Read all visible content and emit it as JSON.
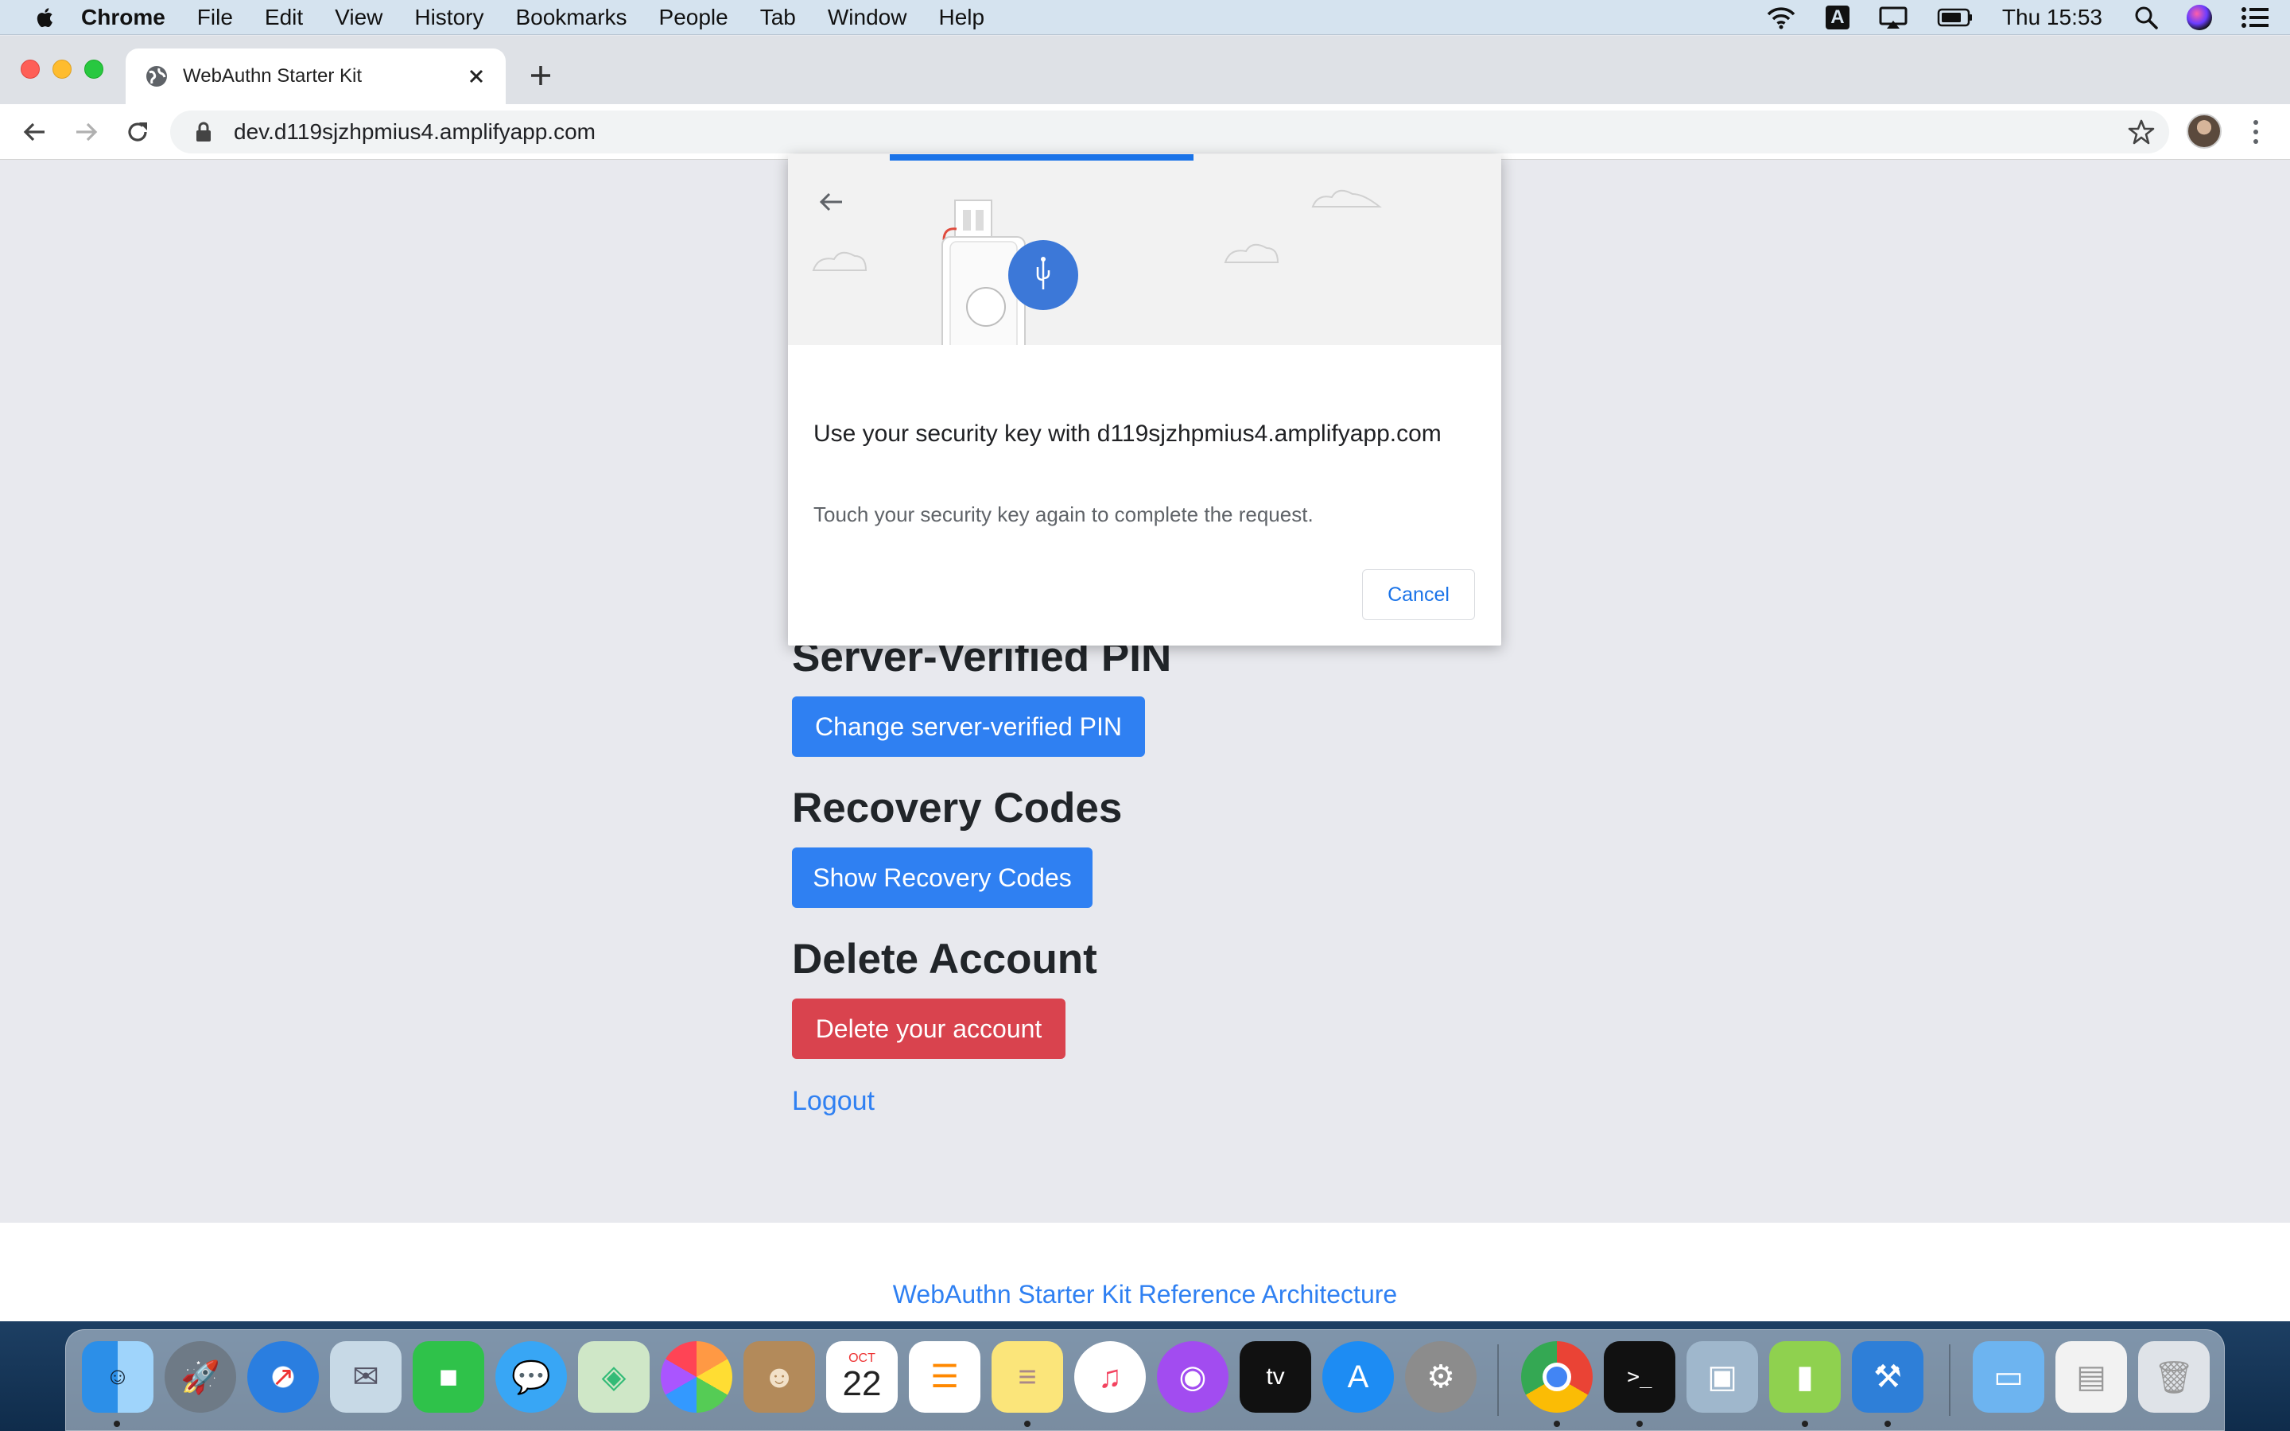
{
  "menubar": {
    "app_name": "Chrome",
    "items": [
      "File",
      "Edit",
      "View",
      "History",
      "Bookmarks",
      "People",
      "Tab",
      "Window",
      "Help"
    ],
    "clock": "Thu 15:53",
    "input_source": "A"
  },
  "browser": {
    "tab_title": "WebAuthn Starter Kit",
    "url": "dev.d119sjzhpmius4.amplifyapp.com"
  },
  "page": {
    "sections": [
      {
        "title": "Server-Verified PIN",
        "button": "Change server-verified PIN"
      },
      {
        "title": "Recovery Codes",
        "button": "Show Recovery Codes"
      },
      {
        "title": "Delete Account",
        "button": "Delete your account"
      }
    ],
    "logout": "Logout",
    "footer_link": "WebAuthn Starter Kit Reference Architecture"
  },
  "dialog": {
    "heading": "Use your security key with d119sjzhpmius4.amplifyapp.com",
    "description": "Touch your security key again to complete the request.",
    "cancel_label": "Cancel",
    "progress": 0.43,
    "accent_color": "#1a73e8"
  },
  "colors": {
    "primary_button": "#2f80f2",
    "danger_button": "#d9434e",
    "page_background": "#e8e9ee"
  },
  "dock": {
    "apps": [
      "Finder",
      "Launchpad",
      "Safari",
      "Mail",
      "FaceTime",
      "Messages",
      "Maps",
      "Photos",
      "Contacts",
      "Calendar",
      "Reminders",
      "Notes",
      "Music",
      "Podcasts",
      "TV",
      "App Store",
      "System Preferences",
      "Chrome",
      "Terminal",
      "Preview",
      "Archive Utility",
      "Xcode",
      "Downloads",
      "Documents",
      "Trash"
    ],
    "calendar_month": "OCT",
    "calendar_day": "22"
  }
}
